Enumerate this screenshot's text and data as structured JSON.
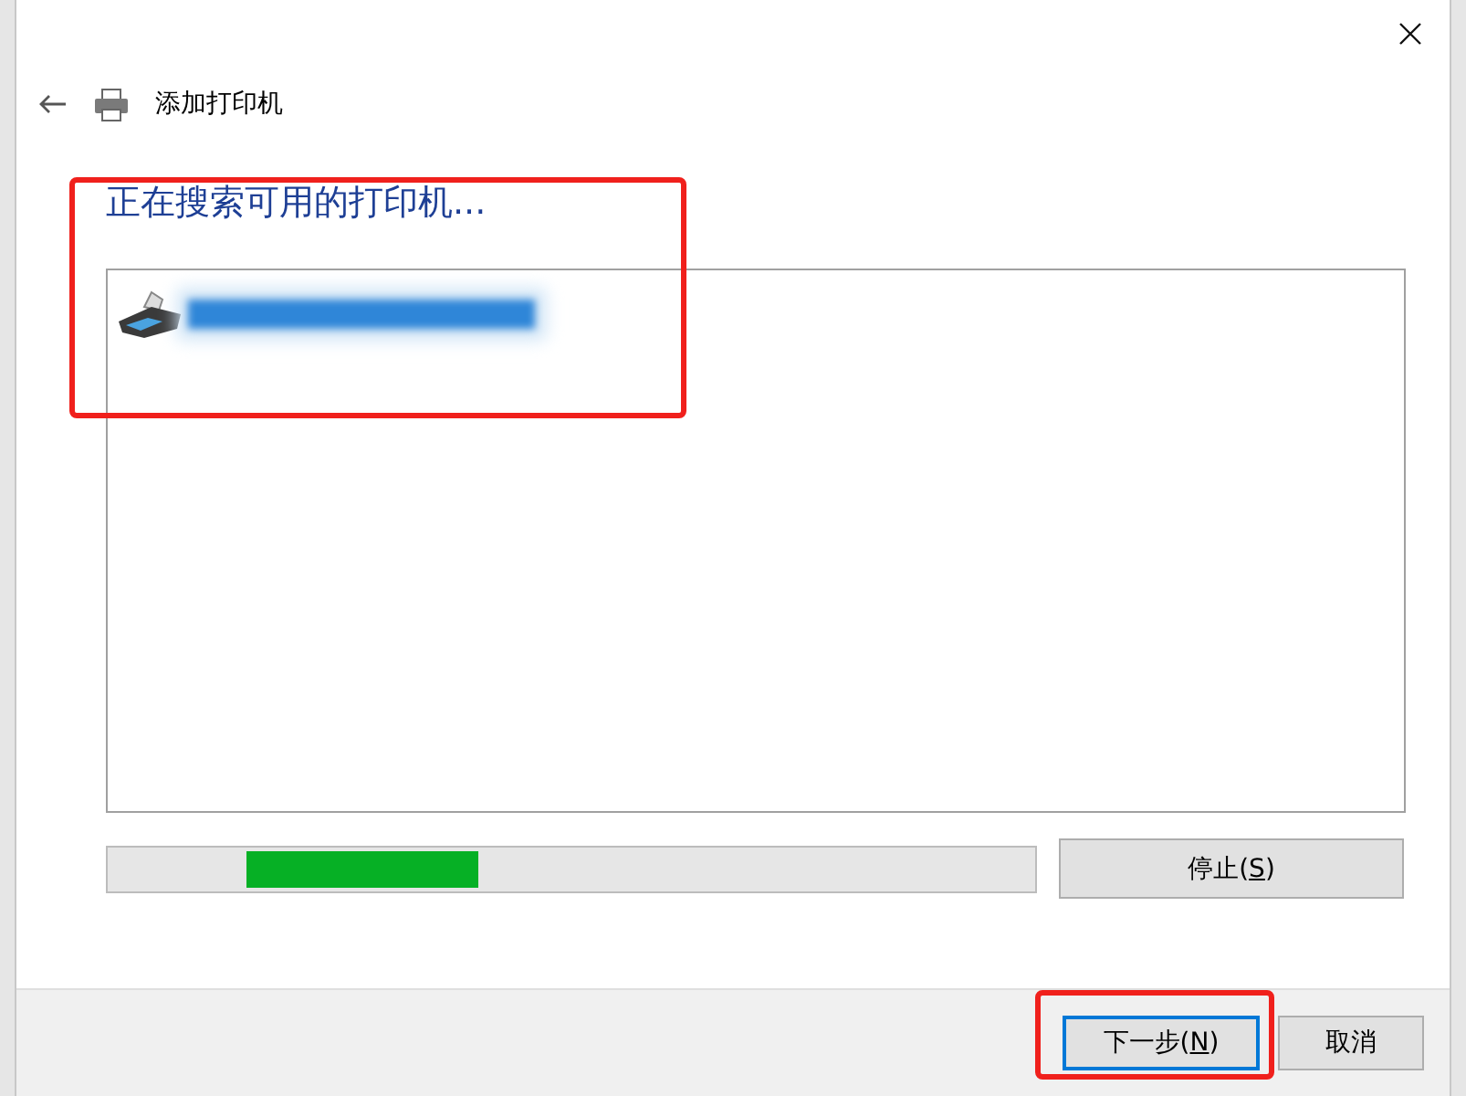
{
  "window": {
    "title": "添加打印机"
  },
  "heading": "正在搜索可用的打印机...",
  "printers": [
    {
      "name_blurred": true
    }
  ],
  "progress": {
    "searching": true
  },
  "stop_button": {
    "label_before": "停止(",
    "access_key": "S",
    "label_after": ")"
  },
  "footer_buttons": [
    {
      "label_before": "下一步(",
      "access_key": "N",
      "label_after": ")",
      "default": true
    },
    {
      "label_before": "取消",
      "default": false
    }
  ]
}
